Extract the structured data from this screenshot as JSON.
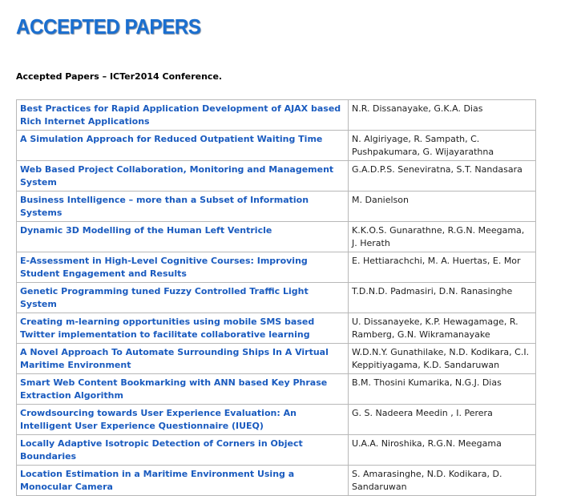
{
  "heading": "ACCEPTED PAPERS",
  "intro": "Accepted Papers – ICTer2014 Conference.",
  "papers": [
    {
      "title": "Best Practices for Rapid Application Development of AJAX based Rich Internet Applications",
      "authors": "N.R. Dissanayake, G.K.A. Dias"
    },
    {
      "title": "A Simulation Approach for Reduced Outpatient Waiting Time",
      "authors": "N. Algiriyage, R. Sampath, C. Pushpakumara, G. Wijayarathna"
    },
    {
      "title": "Web Based Project Collaboration, Monitoring and Management System",
      "authors": "G.A.D.P.S. Seneviratna, S.T. Nandasara"
    },
    {
      "title": "Business Intelligence – more than  a Subset of Information Systems",
      "authors": "M. Danielson"
    },
    {
      "title": "Dynamic 3D Modelling of the Human Left Ventricle",
      "authors": "K.K.O.S. Gunarathne, R.G.N. Meegama, J. Herath"
    },
    {
      "title": "E-Assessment in High-Level Cognitive Courses: Improving Student Engagement and Results",
      "authors": "E. Hettiarachchi, M. A. Huertas, E. Mor"
    },
    {
      "title": "Genetic Programming tuned Fuzzy Controlled Traffic Light System",
      "authors": "T.D.N.D. Padmasiri, D.N. Ranasinghe"
    },
    {
      "title": "Creating m-learning opportunities using mobile SMS based Twitter implementation to facilitate collaborative learning",
      "authors": "U. Dissanayeke, K.P. Hewagamage, R. Ramberg, G.N. Wikramanayake"
    },
    {
      "title": "A Novel Approach To Automate Surrounding Ships In A Virtual Maritime Environment",
      "authors": "W.D.N.Y. Gunathilake, N.D. Kodikara, C.I. Keppitiyagama, K.D. Sandaruwan"
    },
    {
      "title": "Smart Web Content Bookmarking with ANN based Key Phrase Extraction Algorithm",
      "authors": "B.M. Thosini Kumarika, N.G.J. Dias"
    },
    {
      "title": "Crowdsourcing towards User Experience Evaluation: An Intelligent User Experience Questionnaire (IUEQ)",
      "authors": "G. S. Nadeera Meedin , I. Perera"
    },
    {
      "title": "Locally Adaptive Isotropic Detection of Corners in Object Boundaries",
      "authors": "U.A.A. Niroshika, R.G.N. Meegama"
    },
    {
      "title": "Location Estimation in a Maritime Environment Using a Monocular Camera",
      "authors": "S. Amarasinghe, N.D. Kodikara, D. Sandaruwan"
    }
  ]
}
